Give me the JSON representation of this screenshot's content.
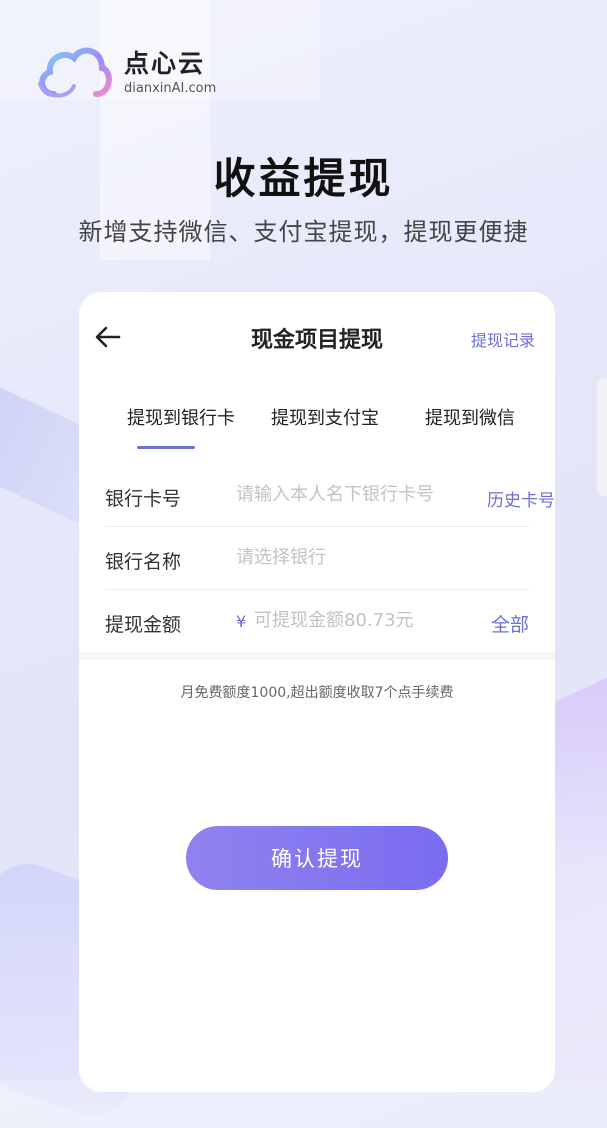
{
  "brand": {
    "name": "点心云",
    "domain": "dianxinAI.com"
  },
  "headline": "收益提现",
  "subhead": "新增支持微信、支付宝提现，提现更便捷",
  "nav": {
    "title": "现金项目提现",
    "records_link": "提现记录"
  },
  "tabs": [
    {
      "label": "提现到银行卡",
      "active": true
    },
    {
      "label": "提现到支付宝",
      "active": false
    },
    {
      "label": "提现到微信",
      "active": false
    }
  ],
  "form": {
    "card_number": {
      "label": "银行卡号",
      "placeholder": "请输入本人名下银行卡号",
      "action": "历史卡号"
    },
    "bank_name": {
      "label": "银行名称",
      "placeholder": "请选择银行"
    },
    "amount": {
      "label": "提现金额",
      "currency": "¥",
      "placeholder": "可提现金额80.73元",
      "action": "全部"
    }
  },
  "note": "月免费额度1000,超出额度收取7个点手续费",
  "confirm_label": "确认提现",
  "colors": {
    "accent": "#6b6fd6",
    "button_start": "#8e83ee",
    "button_end": "#7a6cf0"
  }
}
